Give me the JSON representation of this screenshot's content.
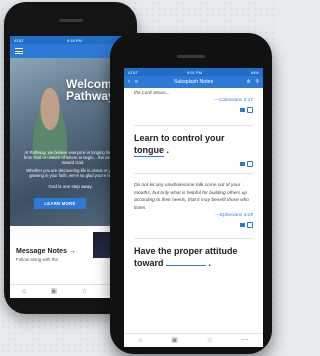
{
  "colors": {
    "accent": "#2d7ad6",
    "status_bar": "#1f6ec8"
  },
  "back_phone": {
    "status": {
      "carrier": "AT&T",
      "time": "9:18 PM"
    },
    "hero": {
      "welcome_line1": "Welcome",
      "welcome_line2": "Pathway",
      "body": "At Pathway, we believe everyone is longing for more from God or unsure of where to begin... the next step toward God.",
      "body2": "Whether you are discovering life in Jesus or you're growing in your faith, we're so glad you're here.",
      "tagline": "God is one step away.",
      "button_label": "LEARN MORE"
    },
    "notes": {
      "title": "Message Notes",
      "arrow": "→",
      "subtitle": "Follow along with the"
    },
    "tabbar": {
      "home_icon": "⌂",
      "calendar_icon": "▣",
      "star_icon": "☆",
      "more_icon": "⋯"
    }
  },
  "front_phone": {
    "status": {
      "carrier": "AT&T",
      "time": "9:51 PM",
      "battery": "64%"
    },
    "nav": {
      "back_icon": "‹",
      "menu_icon": "≡",
      "title": "Subsplash Notes",
      "chart_icon": "ılı",
      "search_icon": "⚲"
    },
    "quote1": {
      "text": "the Lord Jesus...",
      "ref": "—Colossians 3:17"
    },
    "heading1": {
      "text": "Learn to control your",
      "fill": "tongue",
      "punct": "."
    },
    "quote2": {
      "text": "Do not let any unwholesome talk come out of your mouths, but only what is helpful for building others up according to their needs, that it may benefit those who listen.",
      "ref": "—Ephesians 4:29"
    },
    "heading2": {
      "line1": "Have the proper attitude",
      "line2": "toward",
      "punct": "."
    },
    "tabbar": {
      "home_icon": "⌂",
      "calendar_icon": "▣",
      "star_icon": "☆",
      "more_icon": "⋯"
    }
  }
}
